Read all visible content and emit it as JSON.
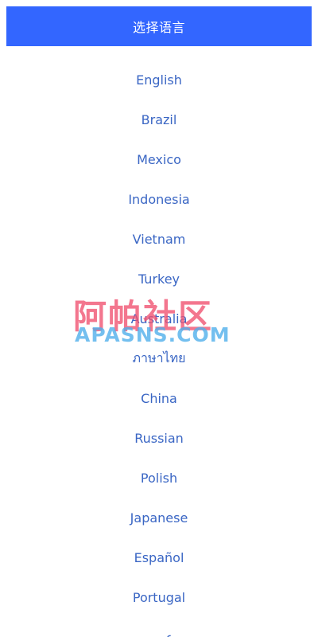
{
  "header": {
    "title": "选择语言",
    "background_color": "#3366ff",
    "text_color": "#ffffff"
  },
  "languages": [
    {
      "label": "English"
    },
    {
      "label": "Brazil"
    },
    {
      "label": "Mexico"
    },
    {
      "label": "Indonesia"
    },
    {
      "label": "Vietnam"
    },
    {
      "label": "Turkey"
    },
    {
      "label": "Australia"
    },
    {
      "label": "ภาษาไทย"
    },
    {
      "label": "China"
    },
    {
      "label": "Russian"
    },
    {
      "label": "Polish"
    },
    {
      "label": "Japanese"
    },
    {
      "label": "Español"
    },
    {
      "label": "Portugal"
    },
    {
      "label": "عربي"
    }
  ],
  "list_text_color": "#3a66c4",
  "watermark": {
    "text_cn": "阿帕社区",
    "text_en": "APASNS.COM",
    "color_cn": "#f0506e",
    "color_en": "#50afeb"
  }
}
